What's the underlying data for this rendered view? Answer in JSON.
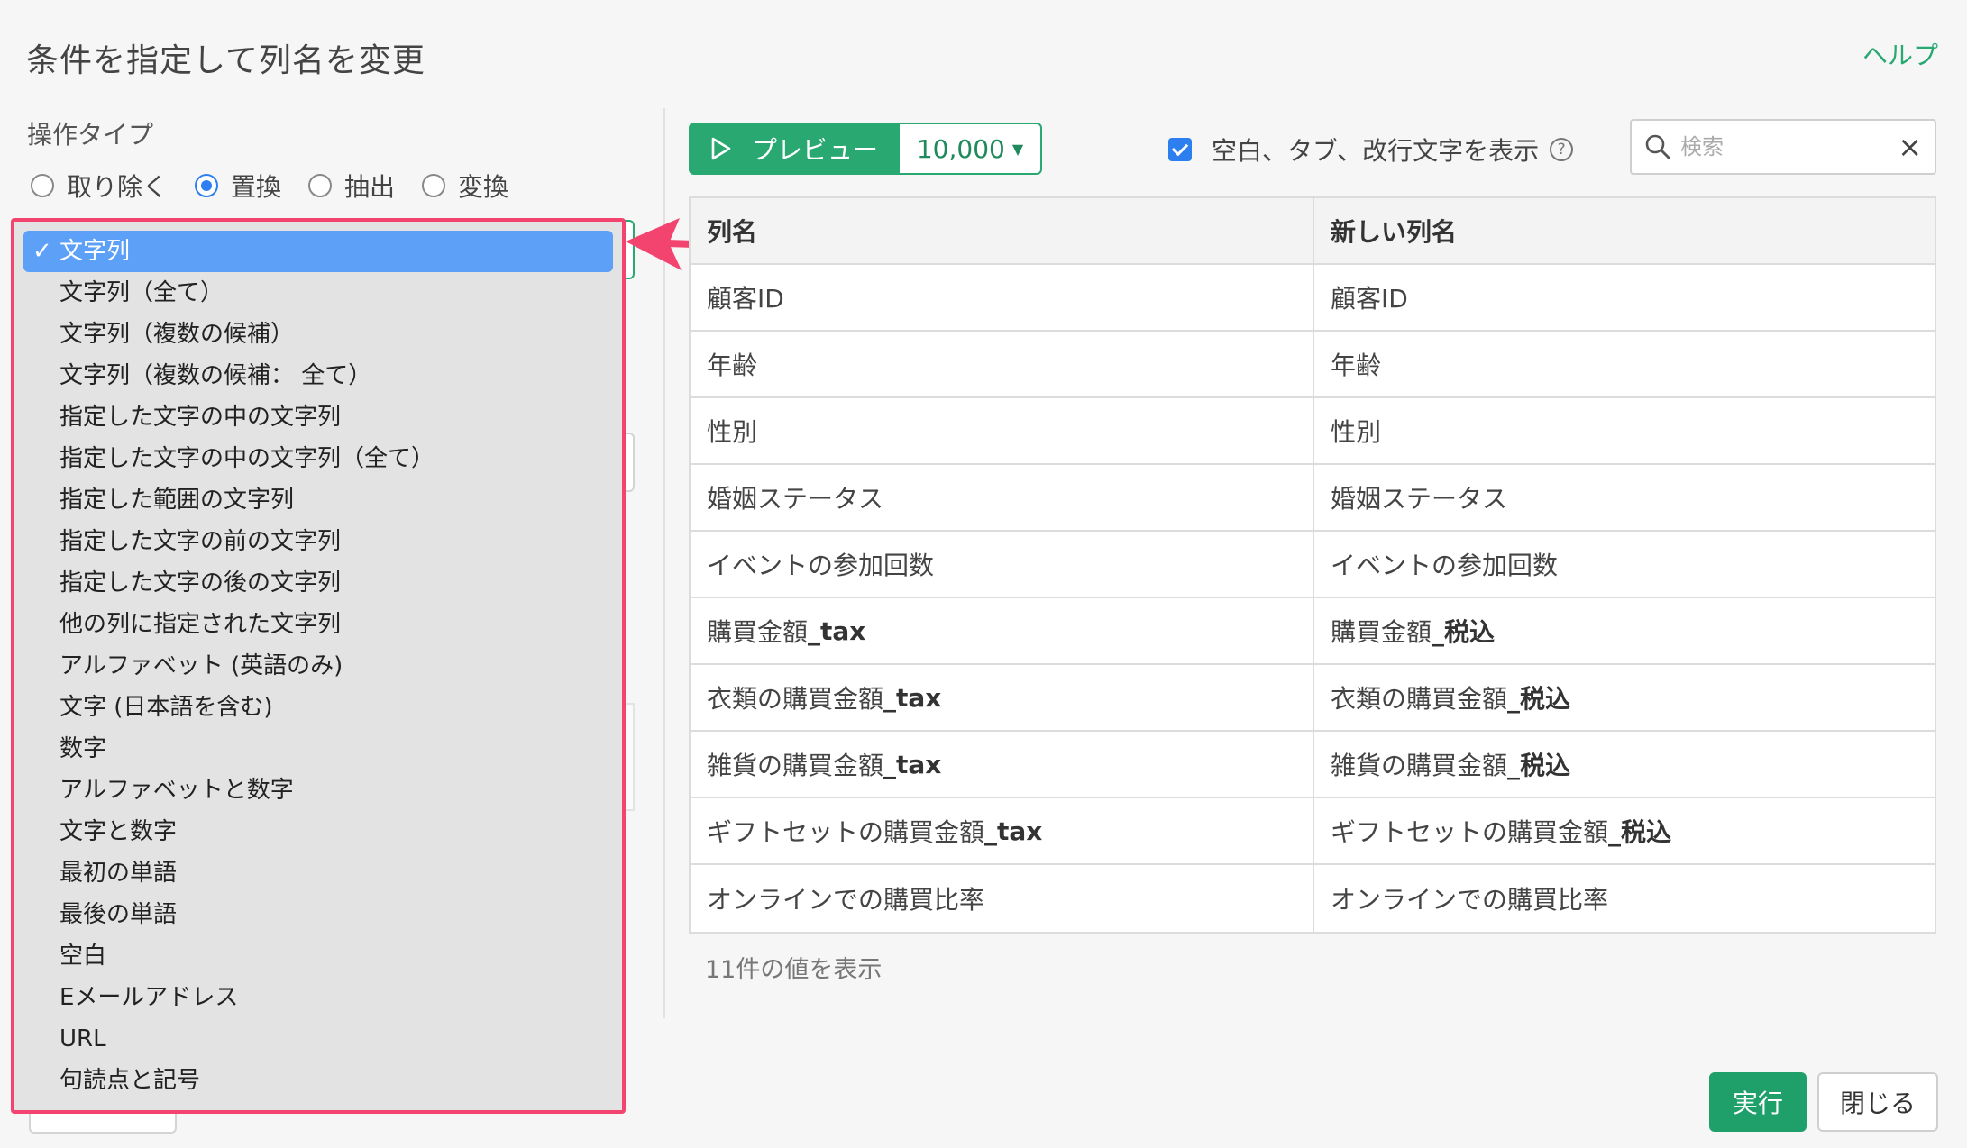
{
  "dialog": {
    "title": "条件を指定して列名を変更",
    "help_label": "ヘルプ"
  },
  "operation": {
    "label": "操作タイプ",
    "options": [
      {
        "label": "取り除く",
        "selected": false
      },
      {
        "label": "置換",
        "selected": true
      },
      {
        "label": "抽出",
        "selected": false
      },
      {
        "label": "変換",
        "selected": false
      }
    ]
  },
  "dropdown": {
    "selected_index": 0,
    "items": [
      "文字列",
      "文字列（全て）",
      "文字列（複数の候補）",
      "文字列（複数の候補： 全て）",
      "指定した文字の中の文字列",
      "指定した文字の中の文字列（全て）",
      "指定した範囲の文字列",
      "指定した文字の前の文字列",
      "指定した文字の後の文字列",
      "他の列に指定された文字列",
      "アルファベット (英語のみ)",
      "文字 (日本語を含む)",
      "数字",
      "アルファベットと数字",
      "文字と数字",
      "最初の単語",
      "最後の単語",
      "空白",
      "Eメールアドレス",
      "URL",
      "句読点と記号"
    ],
    "check_mark": "✓"
  },
  "toolbar": {
    "preview_label": "プレビュー",
    "row_count": "10,000",
    "show_whitespace_label": "空白、タブ、改行文字を表示",
    "show_whitespace_checked": true,
    "help_mark": "?",
    "search_placeholder": "検索",
    "clear_icon": "×"
  },
  "table": {
    "headers": [
      "列名",
      "新しい列名"
    ],
    "rows": [
      {
        "old": "顧客ID",
        "old_bold": "",
        "new": "顧客ID",
        "new_bold": ""
      },
      {
        "old": "年齢",
        "old_bold": "",
        "new": "年齢",
        "new_bold": ""
      },
      {
        "old": "性別",
        "old_bold": "",
        "new": "性別",
        "new_bold": ""
      },
      {
        "old": "婚姻ステータス",
        "old_bold": "",
        "new": "婚姻ステータス",
        "new_bold": ""
      },
      {
        "old": "イベントの参加回数",
        "old_bold": "",
        "new": "イベントの参加回数",
        "new_bold": ""
      },
      {
        "old": "購買金額",
        "old_bold": "_tax",
        "new": "購買金額",
        "new_bold": "_税込"
      },
      {
        "old": "衣類の購買金額",
        "old_bold": "_tax",
        "new": "衣類の購買金額",
        "new_bold": "_税込"
      },
      {
        "old": "雑貨の購買金額",
        "old_bold": "_tax",
        "new": "雑貨の購買金額",
        "new_bold": "_税込"
      },
      {
        "old": "ギフトセットの購買金額",
        "old_bold": "_tax",
        "new": "ギフトセットの購買金額",
        "new_bold": "_税込"
      },
      {
        "old": "オンラインでの購買比率",
        "old_bold": "",
        "new": "オンラインでの購買比率",
        "new_bold": ""
      }
    ],
    "footer": "11件の値を表示"
  },
  "actions": {
    "run_label": "実行",
    "close_label": "閉じる"
  },
  "colors": {
    "accent_green": "#2aa872",
    "highlight_pink": "#f2446e",
    "selected_blue": "#5da0f7"
  }
}
